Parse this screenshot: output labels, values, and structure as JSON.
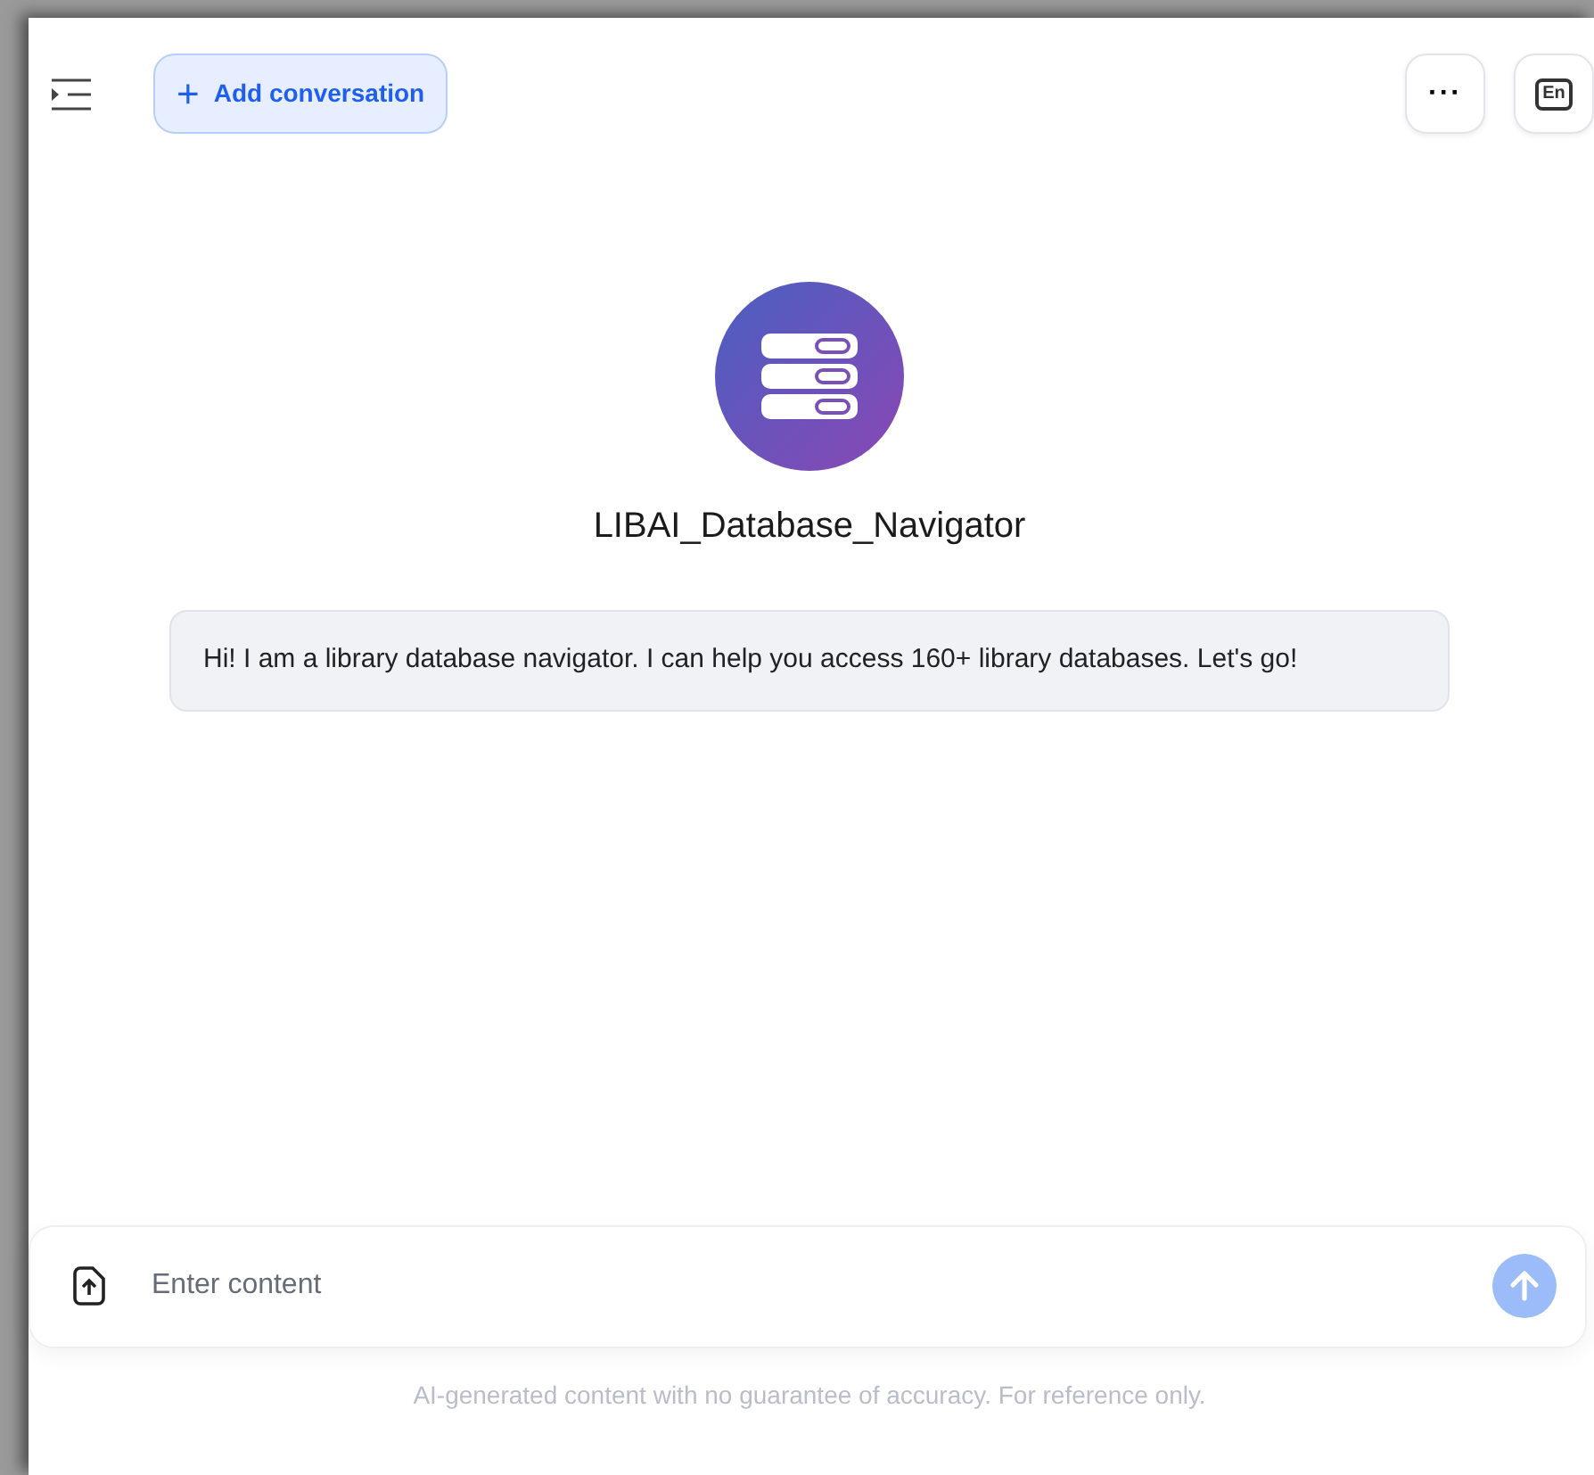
{
  "header": {
    "add_button": {
      "icon": "+",
      "label": "Add conversation"
    },
    "more_button": {
      "label": "···"
    },
    "language_button": {
      "label": "En"
    }
  },
  "bot": {
    "name": "LIBAI_Database_Navigator"
  },
  "messages": [
    {
      "text": "Hi! I am a library database navigator. I can help you access 160+ library databases. Let's go!"
    }
  ],
  "composer": {
    "placeholder": "Enter content",
    "send_disabled": true
  },
  "disclaimer": "AI-generated content with no guarantee of accuracy. For reference only."
}
